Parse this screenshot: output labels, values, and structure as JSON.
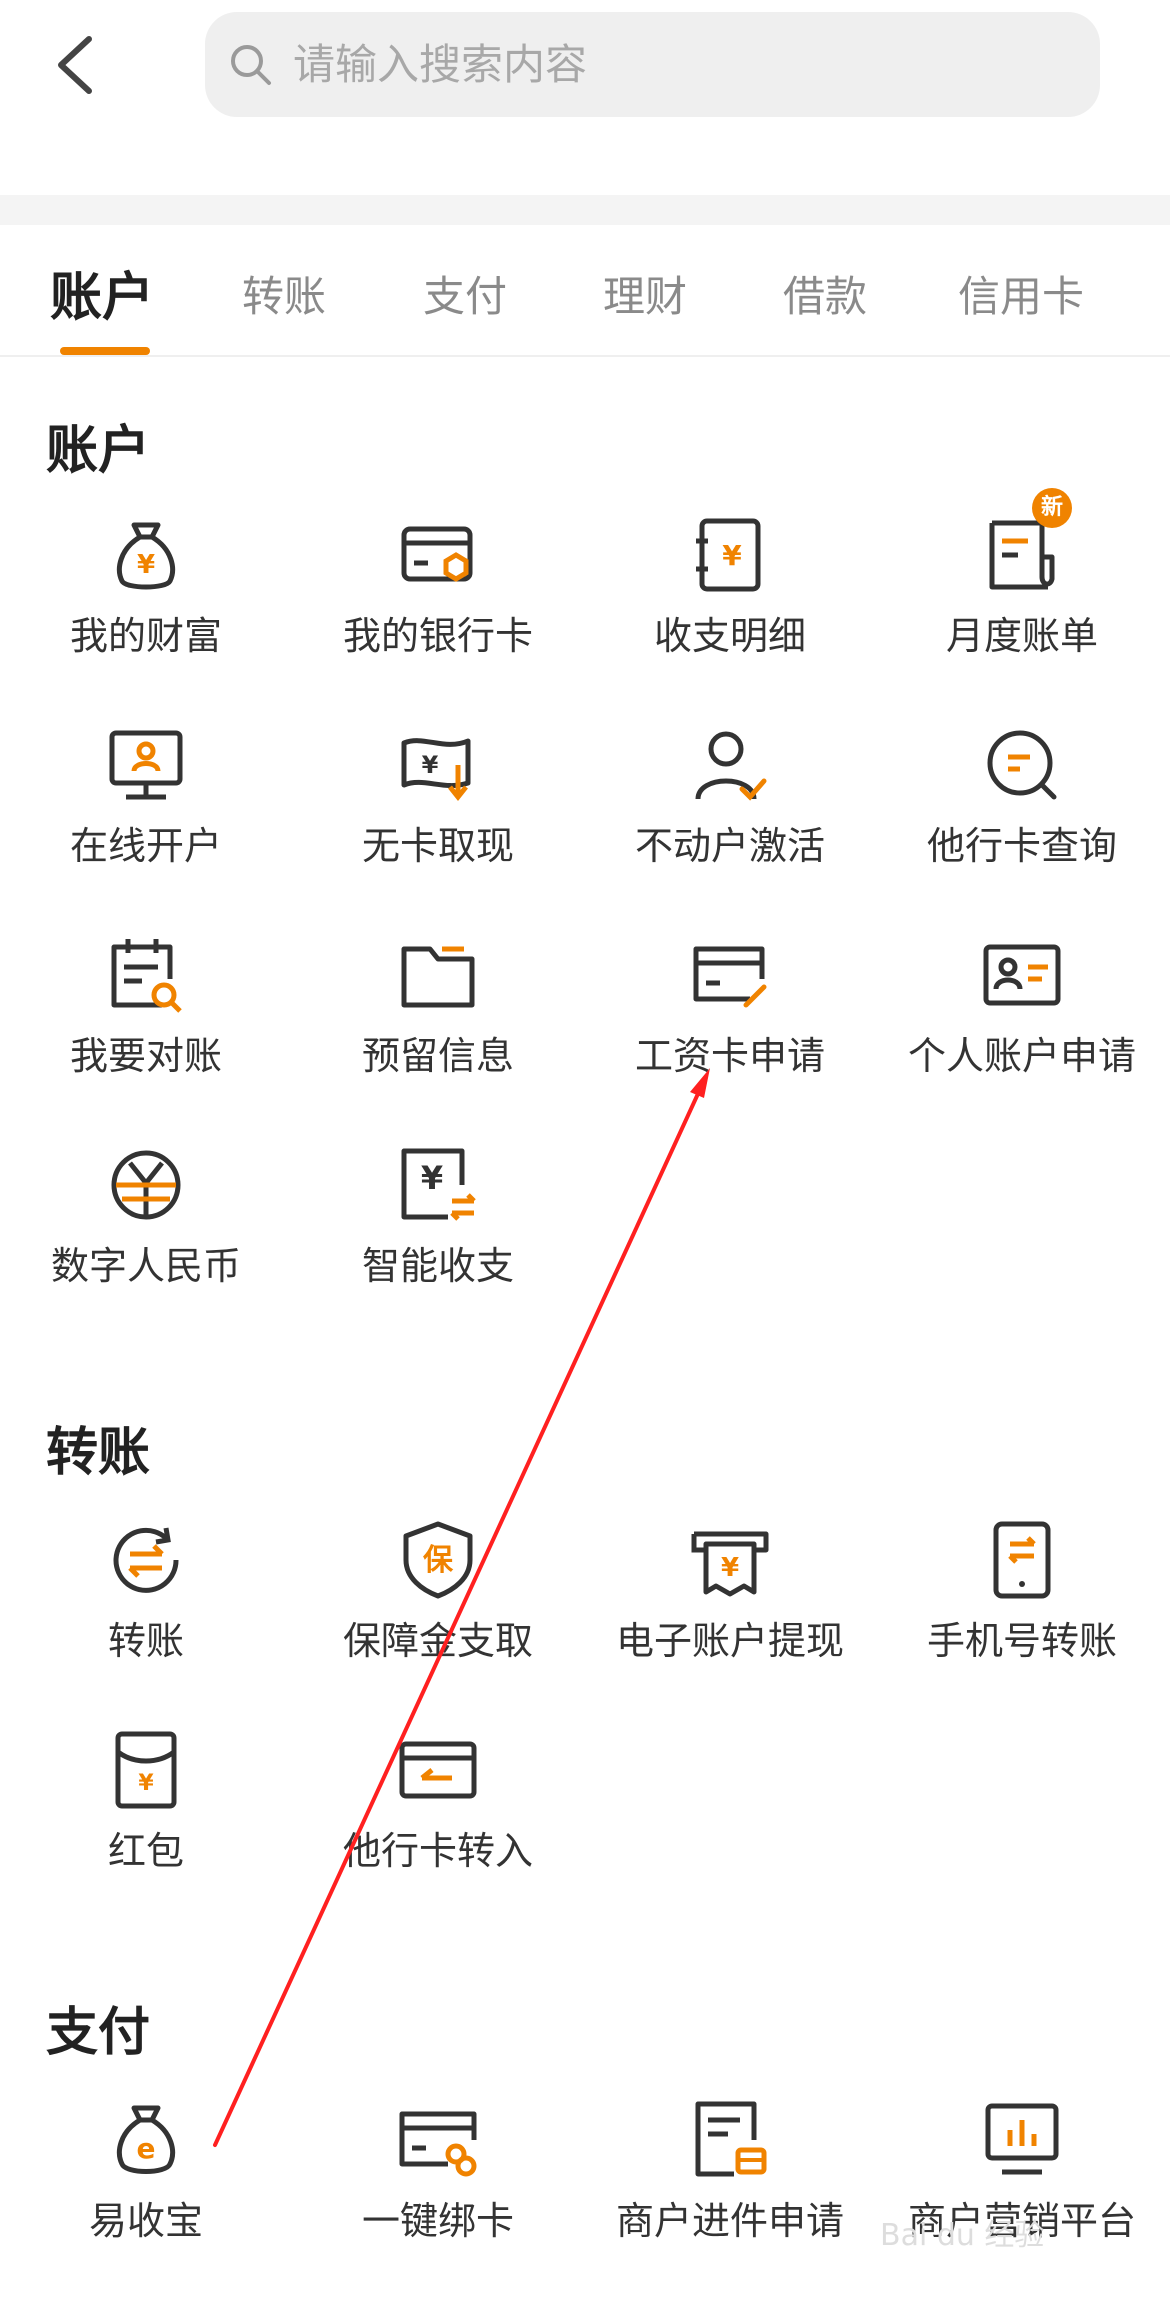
{
  "search": {
    "placeholder": "请输入搜索内容"
  },
  "tabs": [
    {
      "label": "账户",
      "active": true
    },
    {
      "label": "转账"
    },
    {
      "label": "支付"
    },
    {
      "label": "理财"
    },
    {
      "label": "借款"
    },
    {
      "label": "信用卡"
    }
  ],
  "sections": {
    "account": {
      "title": "账户",
      "items": [
        {
          "label": "我的财富",
          "icon": "money-bag-icon"
        },
        {
          "label": "我的银行卡",
          "icon": "bank-card-icon"
        },
        {
          "label": "收支明细",
          "icon": "receipt-icon"
        },
        {
          "label": "月度账单",
          "icon": "monthly-bill-icon",
          "badge": "新"
        },
        {
          "label": "在线开户",
          "icon": "online-account-icon"
        },
        {
          "label": "无卡取现",
          "icon": "cardless-withdraw-icon"
        },
        {
          "label": "不动户激活",
          "icon": "user-activate-icon"
        },
        {
          "label": "他行卡查询",
          "icon": "search-message-icon"
        },
        {
          "label": "我要对账",
          "icon": "reconcile-icon"
        },
        {
          "label": "预留信息",
          "icon": "folder-icon"
        },
        {
          "label": "工资卡申请",
          "icon": "salary-card-icon"
        },
        {
          "label": "个人账户申请",
          "icon": "id-card-icon"
        },
        {
          "label": "数字人民币",
          "icon": "digital-rmb-icon"
        },
        {
          "label": "智能收支",
          "icon": "smart-payment-icon"
        }
      ]
    },
    "transfer": {
      "title": "转账",
      "items": [
        {
          "label": "转账",
          "icon": "transfer-icon"
        },
        {
          "label": "保障金支取",
          "icon": "shield-icon"
        },
        {
          "label": "电子账户提现",
          "icon": "atm-withdraw-icon"
        },
        {
          "label": "手机号转账",
          "icon": "phone-transfer-icon"
        },
        {
          "label": "红包",
          "icon": "red-packet-icon"
        },
        {
          "label": "他行卡转入",
          "icon": "card-transfer-in-icon"
        }
      ]
    },
    "payment": {
      "title": "支付",
      "items": [
        {
          "label": "易收宝",
          "icon": "e-bag-icon"
        },
        {
          "label": "一键绑卡",
          "icon": "card-link-icon"
        },
        {
          "label": "商户进件申请",
          "icon": "merchant-apply-icon"
        },
        {
          "label": "商户营销平台",
          "icon": "marketing-platform-icon"
        }
      ]
    }
  },
  "watermark": "Bai du 经验",
  "colors": {
    "accent": "#f08300",
    "icon": "#333333",
    "annotation": "#ff2020"
  }
}
